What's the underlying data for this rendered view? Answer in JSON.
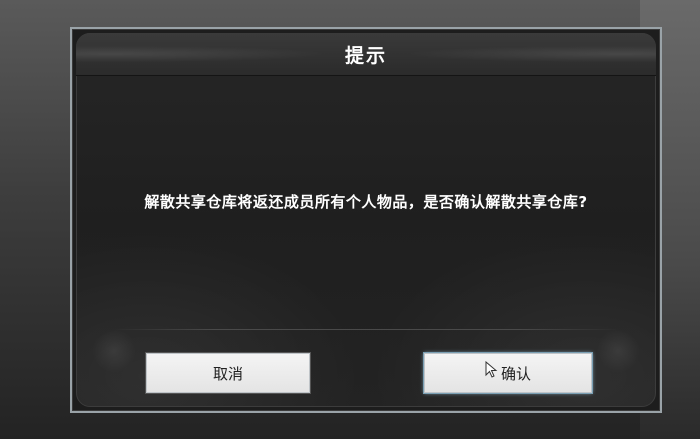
{
  "dialog": {
    "title": "提示",
    "message": "解散共享仓库将返还成员所有个人物品，是否确认解散共享仓库?",
    "cancel_label": "取消",
    "confirm_label": "确认"
  },
  "colors": {
    "dialog_bg": "#1f1f1f",
    "title_text": "#ffffff",
    "button_bg": "#ececec",
    "button_text": "#222222",
    "border": "#9aa3a8"
  },
  "icons": {
    "cursor": "arrow-cursor-icon"
  }
}
